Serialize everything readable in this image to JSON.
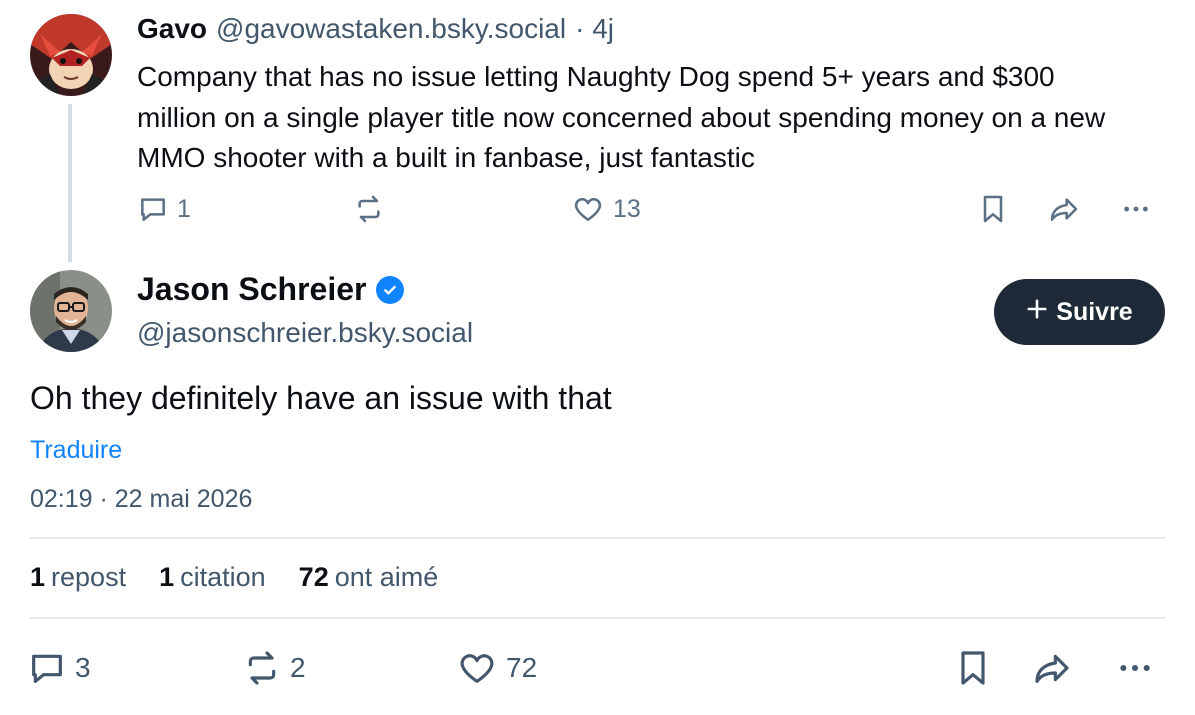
{
  "parent_post": {
    "author_name": "Gavo",
    "author_handle": "@gavowastaken.bsky.social",
    "age": "· 4j",
    "text": "Company that has no issue letting Naughty Dog spend 5+ years and $300 million on a single player title now concerned about spending money on a new MMO shooter with a built in fanbase, just fantastic",
    "actions": {
      "replies": "1",
      "reposts": "",
      "likes": "13"
    }
  },
  "main_post": {
    "author_name": "Jason Schreier",
    "author_handle": "@jasonschreier.bsky.social",
    "follow_label": "Suivre",
    "text": "Oh they definitely have an issue with that",
    "translate_label": "Traduire",
    "timestamp": "02:19 · 22 mai 2026",
    "stats": {
      "reposts_count": "1",
      "reposts_label": "repost",
      "quotes_count": "1",
      "quotes_label": "citation",
      "likes_count": "72",
      "likes_label": "ont aimé"
    },
    "actions": {
      "replies": "3",
      "reposts": "2",
      "likes": "72"
    }
  },
  "colors": {
    "accent": "#1083fe",
    "follow_bg": "#1e2a38",
    "muted": "#42576c",
    "icon": "#5b6f85"
  }
}
